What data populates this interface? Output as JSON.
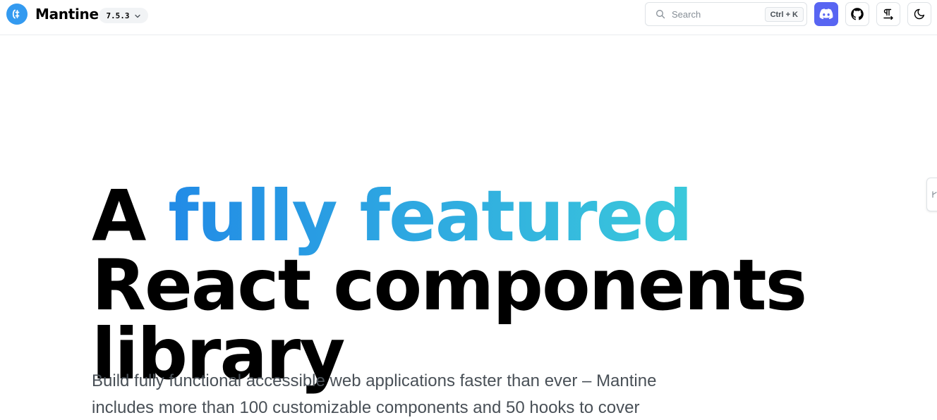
{
  "header": {
    "brand": "Mantine",
    "version": "7.5.3",
    "search": {
      "placeholder": "Search",
      "shortcut": "Ctrl + K"
    },
    "buttons": {
      "discord": {
        "icon": "discord-icon"
      },
      "github": {
        "icon": "github-icon"
      },
      "direction": {
        "icon": "text-direction-icon"
      },
      "color_scheme": {
        "icon": "moon-icon"
      }
    }
  },
  "hero": {
    "title_part1": "A ",
    "title_gradient": "fully featured",
    "title_part2": " React components library",
    "description": "Build fully functional accessible web applications faster than ever – Mantine includes more than 100 customizable components and 50 hooks to cover"
  },
  "colors": {
    "brand": "#339af0",
    "gradient_from": "#228be6",
    "gradient_to": "#3bc9db",
    "discord": "#5865f2",
    "text_muted": "#495057"
  }
}
